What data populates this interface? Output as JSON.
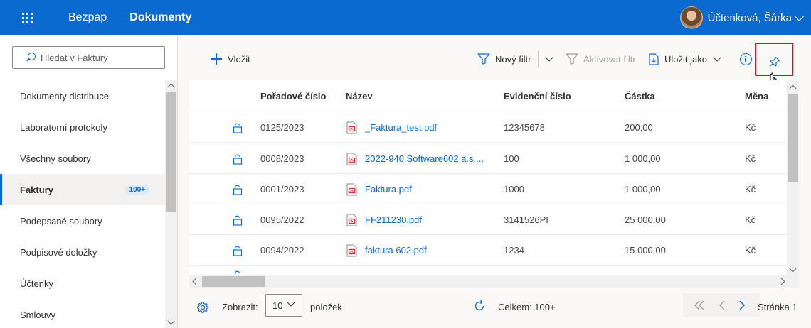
{
  "topbar": {
    "app_name": "Bezpap",
    "page_name": "Dokumenty",
    "user_name": "Účtenková, Šárka"
  },
  "sidebar": {
    "search_placeholder": "Hledat v Faktury",
    "items": [
      {
        "label": "Dokumenty distribuce"
      },
      {
        "label": "Laboratorní protokoly"
      },
      {
        "label": "Všechny soubory"
      },
      {
        "label": "Faktury",
        "badge": "100+",
        "active": true
      },
      {
        "label": "Podepsané soubory"
      },
      {
        "label": "Podpisové doložky"
      },
      {
        "label": "Účtenky"
      },
      {
        "label": "Smlouvy"
      }
    ]
  },
  "toolbar": {
    "insert_label": "Vložit",
    "new_filter_label": "Nový filtr",
    "activate_filter_label": "Aktivovat filtr",
    "save_as_label": "Uložit jako"
  },
  "table": {
    "headers": {
      "order": "Pořadové číslo",
      "name": "Název",
      "evidence": "Evidenční číslo",
      "amount": "Částka",
      "currency": "Měna"
    },
    "rows": [
      {
        "order": "0125/2023",
        "name": "_Faktura_test.pdf",
        "evidence": "12345678",
        "amount": "200,00",
        "currency": "Kč"
      },
      {
        "order": "0008/2023",
        "name": "2022-940 Software602 a.s....",
        "evidence": "100",
        "amount": "1 000,00",
        "currency": "Kč"
      },
      {
        "order": "0001/2023",
        "name": "Faktura.pdf",
        "evidence": "1000",
        "amount": "1 000,00",
        "currency": "Kč"
      },
      {
        "order": "0095/2022",
        "name": "FF211230.pdf",
        "evidence": "3141526PI",
        "amount": "25 000,00",
        "currency": "Kč"
      },
      {
        "order": "0094/2022",
        "name": "faktura 602.pdf",
        "evidence": "1234",
        "amount": "15 000,00",
        "currency": "Kč"
      }
    ]
  },
  "footer": {
    "show_label": "Zobrazit:",
    "page_size": "10",
    "items_label": "položek",
    "total_label": "Celkem: 100+",
    "page_label": "Stránka 1"
  },
  "colors": {
    "brand": "#0b6ad0",
    "highlight": "#e00b1c"
  }
}
